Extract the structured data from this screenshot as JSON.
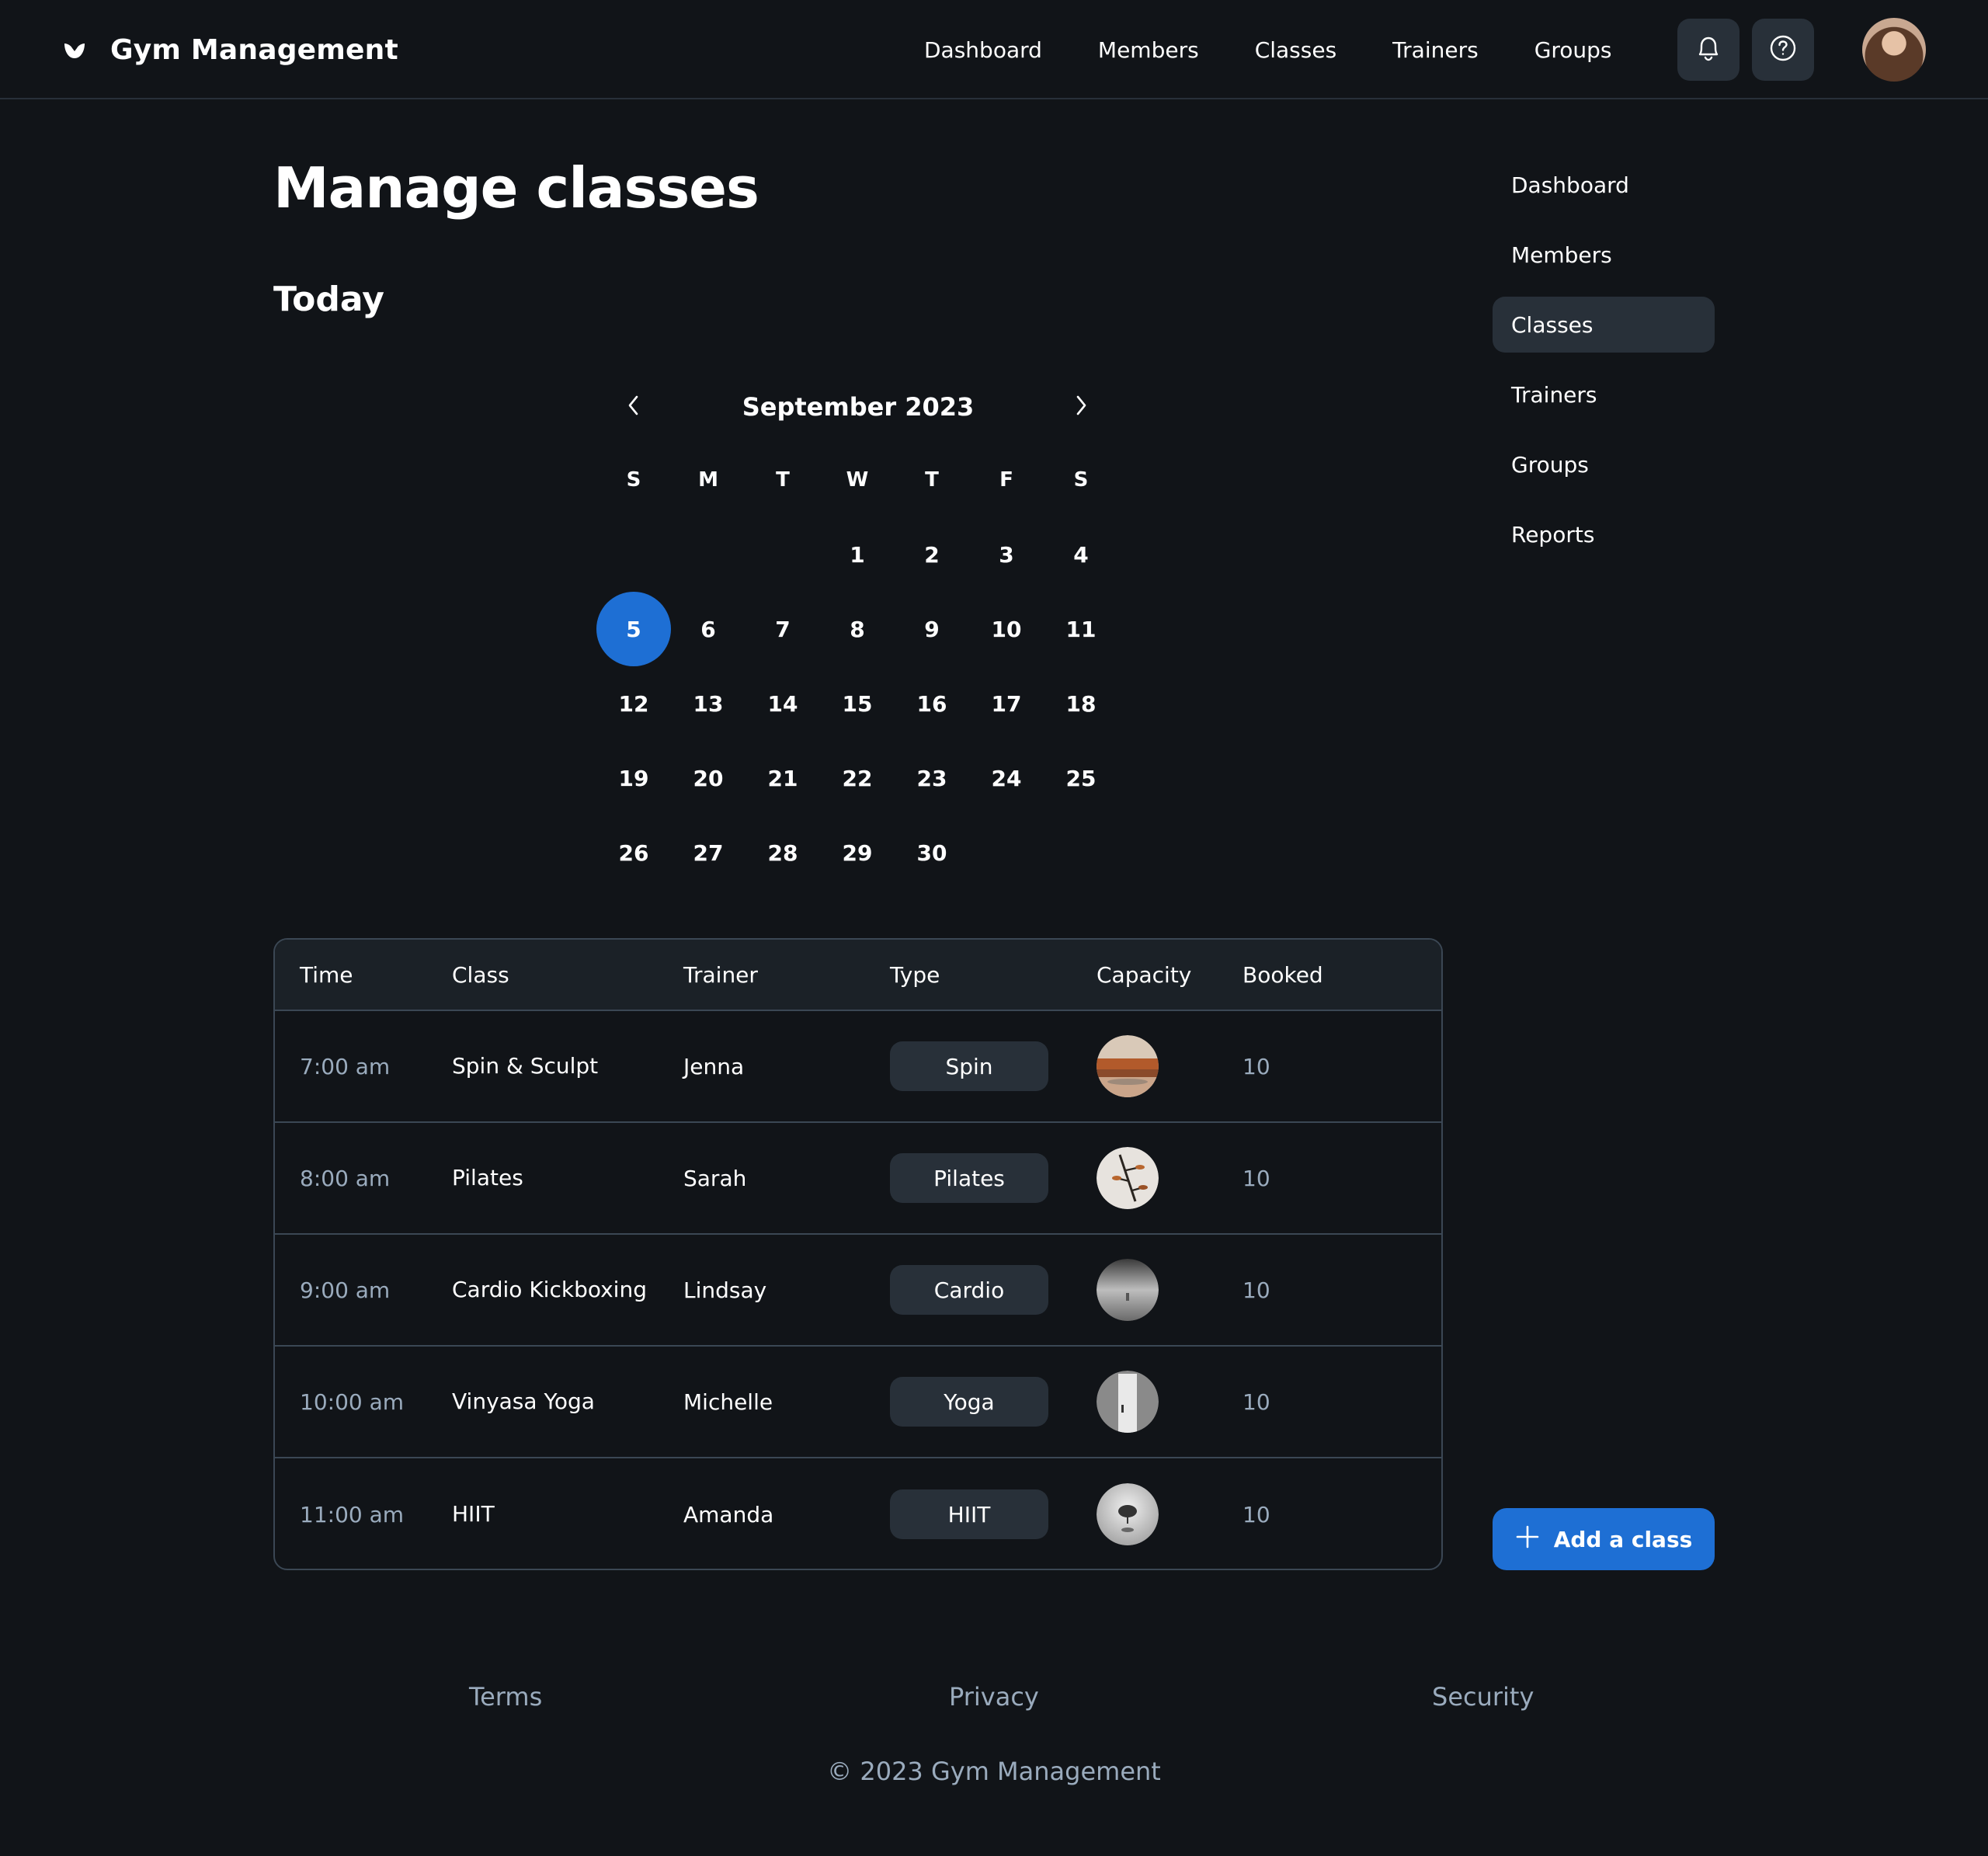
{
  "app": {
    "name": "Gym Management",
    "logo_icon": "gym-logo-icon"
  },
  "topnav": {
    "items": [
      "Dashboard",
      "Members",
      "Classes",
      "Trainers",
      "Groups"
    ],
    "notifications_icon": "bell-icon",
    "help_icon": "help-circle-icon"
  },
  "page": {
    "title": "Manage classes",
    "section": "Today"
  },
  "calendar": {
    "month_label": "September 2023",
    "weekdays": [
      "S",
      "M",
      "T",
      "W",
      "T",
      "F",
      "S"
    ],
    "leading_blank_days": 3,
    "days_in_month": 30,
    "selected_day": 5,
    "prev_icon": "chevron-left-icon",
    "next_icon": "chevron-right-icon"
  },
  "table": {
    "headers": [
      "Time",
      "Class",
      "Trainer",
      "Type",
      "Capacity",
      "Booked"
    ],
    "rows": [
      {
        "time": "7:00 am",
        "class": "Spin & Sculpt",
        "trainer": "Jenna",
        "type": "Spin",
        "booked": "10"
      },
      {
        "time": "8:00 am",
        "class": "Pilates",
        "trainer": "Sarah",
        "type": "Pilates",
        "booked": "10"
      },
      {
        "time": "9:00 am",
        "class": "Cardio Kickboxing",
        "trainer": "Lindsay",
        "type": "Cardio",
        "booked": "10"
      },
      {
        "time": "10:00 am",
        "class": "Vinyasa Yoga",
        "trainer": "Michelle",
        "type": "Yoga",
        "booked": "10"
      },
      {
        "time": "11:00 am",
        "class": "HIIT",
        "trainer": "Amanda",
        "type": "HIIT",
        "booked": "10"
      }
    ]
  },
  "sidebar": {
    "items": [
      "Dashboard",
      "Members",
      "Classes",
      "Trainers",
      "Groups",
      "Reports"
    ],
    "active": "Classes"
  },
  "actions": {
    "add_class": "Add a class",
    "add_icon": "plus-icon"
  },
  "footer": {
    "links": [
      "Terms",
      "Privacy",
      "Security"
    ],
    "copyright": "© 2023 Gym Management"
  },
  "colors": {
    "background": "#111418",
    "surface": "#283039",
    "border": "#3b4754",
    "accent": "#1e6fd4",
    "muted_text": "#9aabbd"
  }
}
